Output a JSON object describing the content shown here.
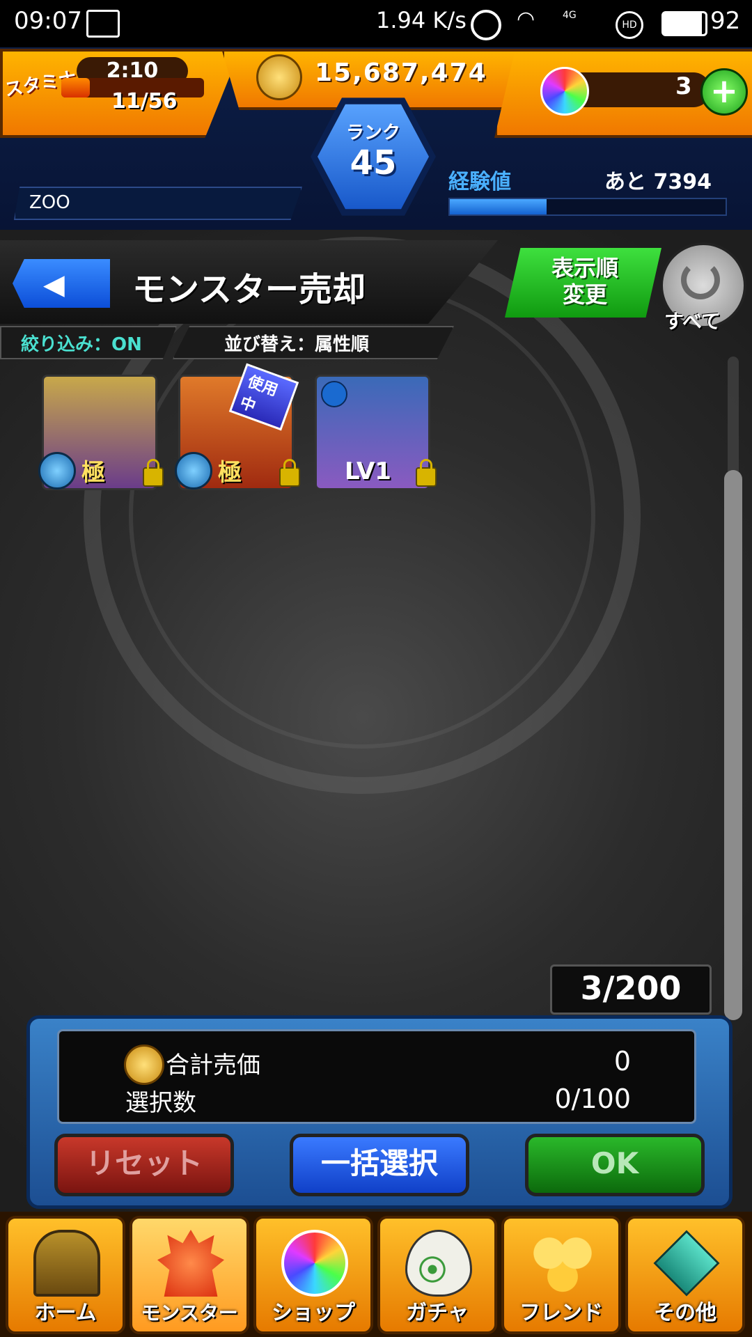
{
  "status_bar": {
    "time": "09:07",
    "speed": "1.94 K/s",
    "network": "4G",
    "hd": "HD",
    "battery": "92"
  },
  "header": {
    "stamina_label": "スタミナ",
    "stamina_timer": "2:10",
    "stamina_value": "11/56",
    "coins": "15,687,474",
    "orbs": "3",
    "rank_label": "ランク",
    "rank_value": "45",
    "player_name": "ZOO",
    "exp_label": "経験値",
    "exp_remaining": "あと 7394",
    "exp_progress": 0.35
  },
  "page": {
    "title": "モンスター売却",
    "filter_label": "絞り込み：ON",
    "sort_label": "並び替え：属性順",
    "sort_change_button": "表示順\n変更",
    "all_button_label": "すべて"
  },
  "monsters": [
    {
      "label": "極",
      "badge": "",
      "color_top": "#c8a84a",
      "color_bottom": "#6a3c8a"
    },
    {
      "label": "極",
      "badge": "使用中",
      "color_top": "#e07a2a",
      "color_bottom": "#a02a10"
    },
    {
      "label": "LV1",
      "badge": "",
      "color_top": "#3a6ab8",
      "color_bottom": "#8a5ac0"
    }
  ],
  "box_count": "3/200",
  "sell": {
    "total_label": "合計売価",
    "total_value": "0",
    "selected_label": "選択数",
    "selected_value": "0/100",
    "reset_button": "リセット",
    "select_all_button": "一括選択",
    "ok_button": "OK"
  },
  "nav": [
    {
      "label": "ホーム",
      "icon": "home-gate-icon"
    },
    {
      "label": "モンスター",
      "icon": "monster-icon"
    },
    {
      "label": "ショップ",
      "icon": "rainbow-orb-icon"
    },
    {
      "label": "ガチャ",
      "icon": "egg-icon"
    },
    {
      "label": "フレンド",
      "icon": "friend-balloon-icon"
    },
    {
      "label": "その他",
      "icon": "other-menu-icon"
    }
  ],
  "colors": {
    "accent_orange": "#f59a10",
    "header_blue": "#0c1e46",
    "green_button": "#1fa81f",
    "red_button": "#a3261a",
    "blue_button": "#1d5fe0"
  }
}
